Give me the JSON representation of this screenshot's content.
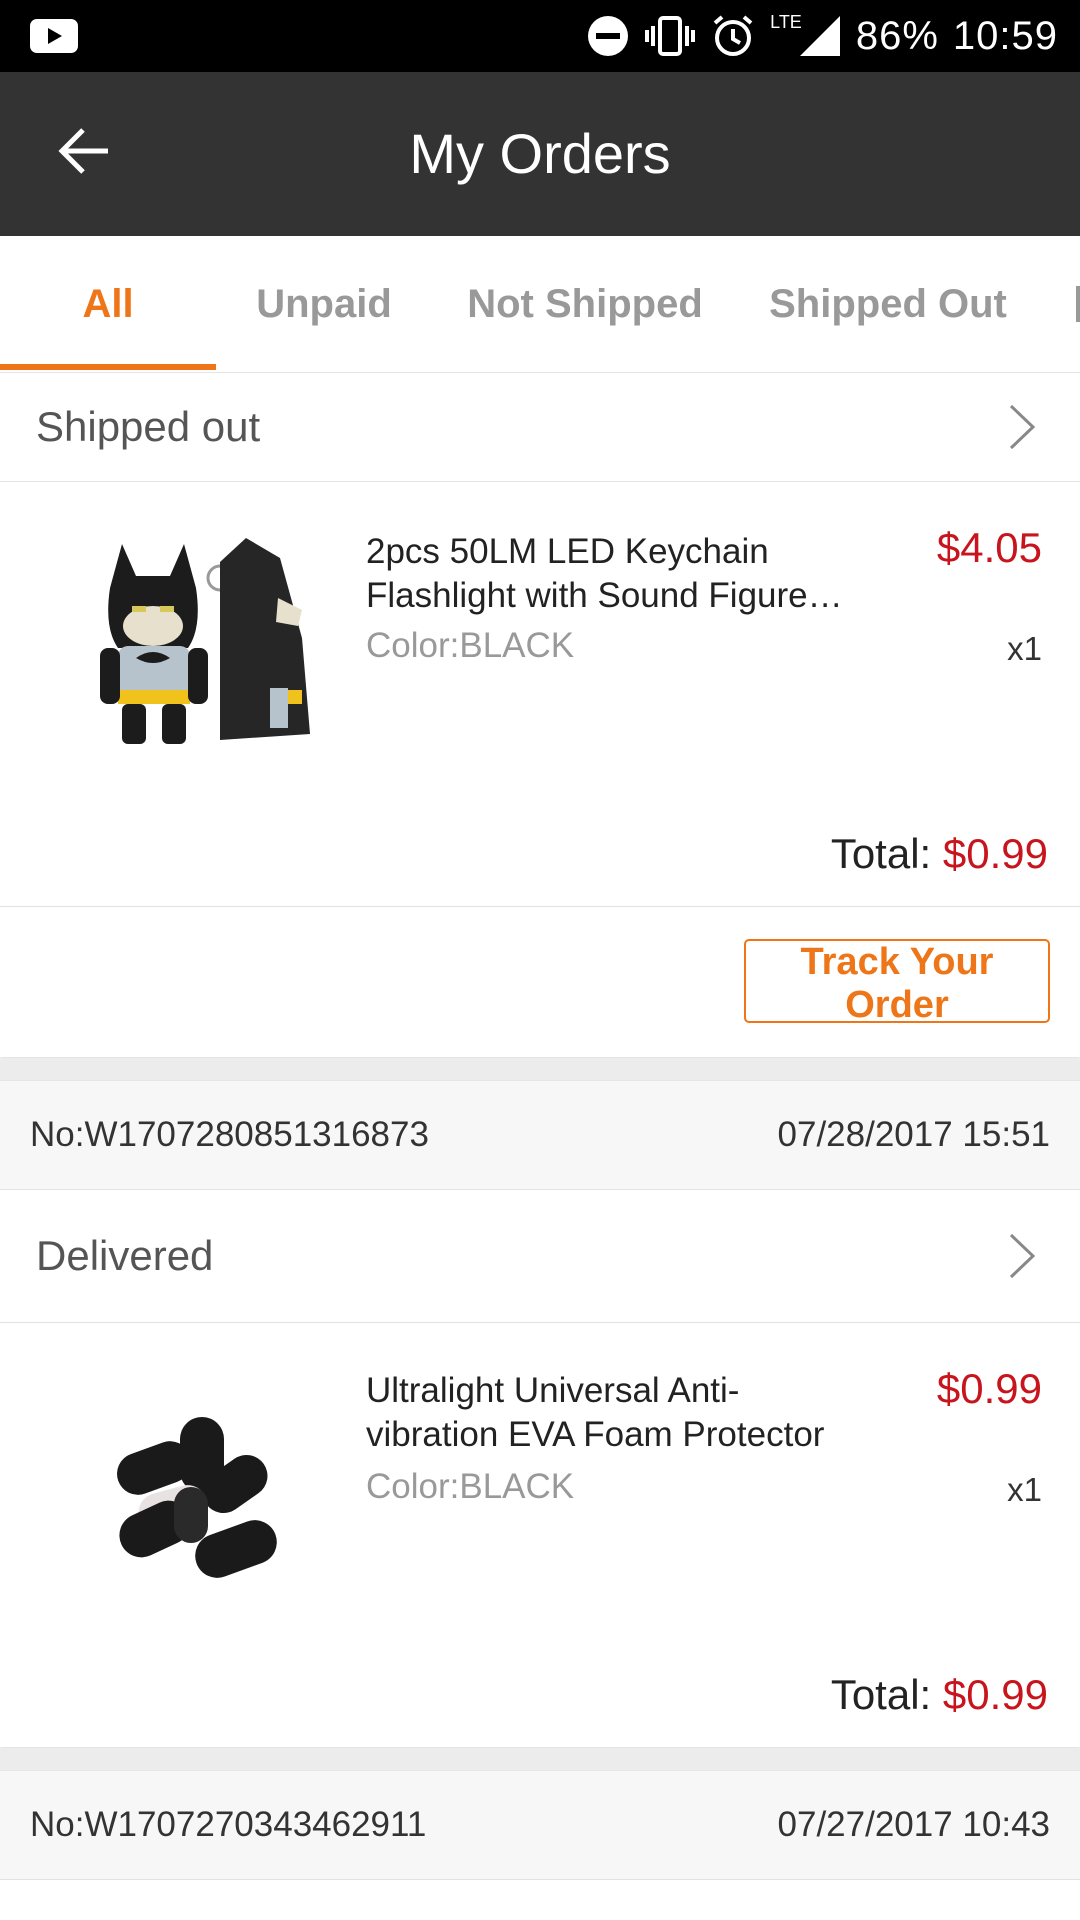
{
  "status_bar": {
    "battery": "86%",
    "time": "10:59",
    "network": "LTE"
  },
  "header": {
    "title": "My Orders"
  },
  "tabs": [
    {
      "label": "All",
      "active": true
    },
    {
      "label": "Unpaid",
      "active": false
    },
    {
      "label": "Not Shipped",
      "active": false
    },
    {
      "label": "Shipped Out",
      "active": false
    }
  ],
  "orders": [
    {
      "status": "Shipped out",
      "item": {
        "name": "2pcs 50LM LED Keychain Flashlight with Sound Figure…",
        "price": "$4.05",
        "color": "Color:BLACK",
        "qty": "x1",
        "image_icon": "batman-keychain-image"
      },
      "total_label": "Total: ",
      "total_value": "$0.99",
      "action_label": "Track Your Order"
    },
    {
      "number": "No:W1707280851316873",
      "datetime": "07/28/2017 15:51",
      "status": "Delivered",
      "item": {
        "name": "Ultralight Universal Anti-vibration EVA Foam Protector",
        "price": "$0.99",
        "color": "Color:BLACK",
        "qty": "x1",
        "image_icon": "foam-pads-image"
      },
      "total_label": "Total: ",
      "total_value": "$0.99"
    },
    {
      "number": "No:W1707270343462911",
      "datetime": "07/27/2017 10:43"
    }
  ],
  "colors": {
    "accent": "#ee7618",
    "price": "#c8151d",
    "appbar": "#333333"
  }
}
